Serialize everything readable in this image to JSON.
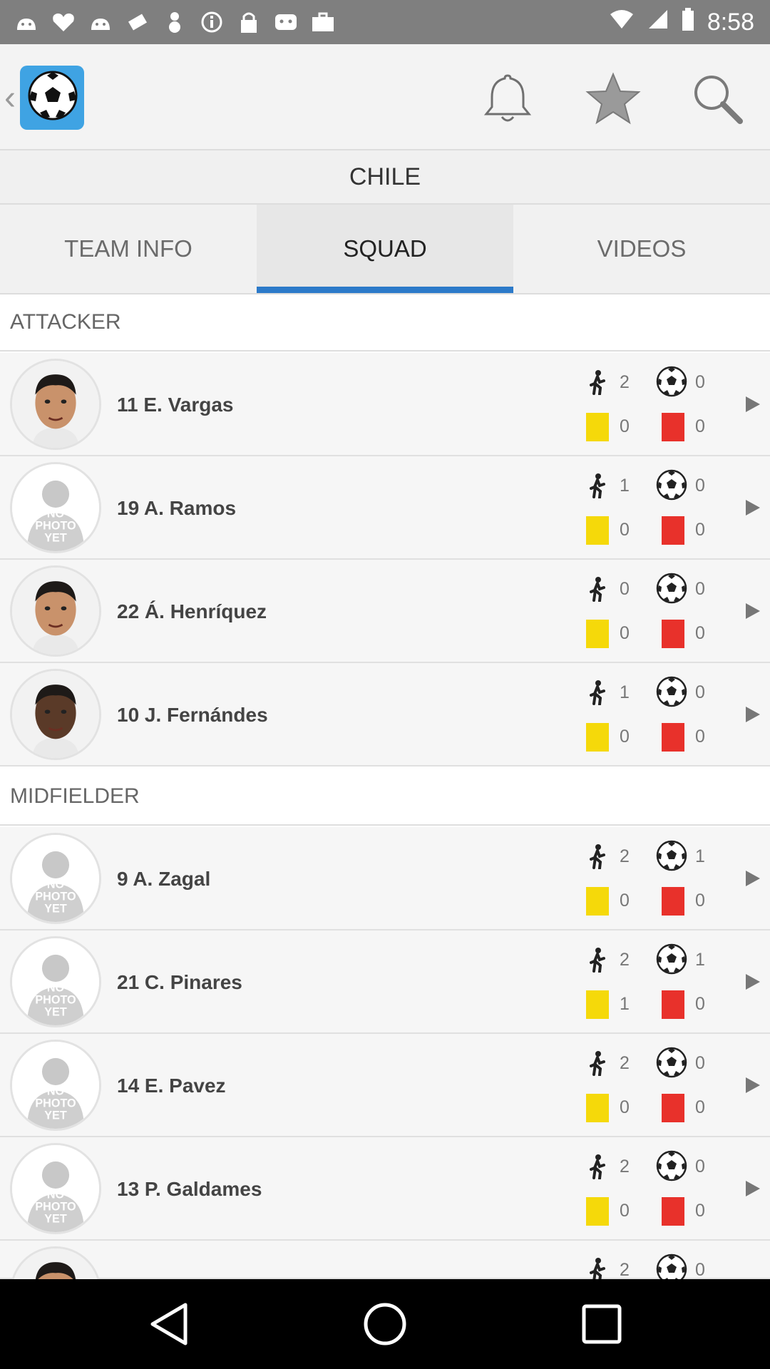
{
  "status_bar": {
    "time": "8:58",
    "left_icons": [
      "android-icon",
      "heart-icon",
      "android-icon",
      "fake-gps-icon",
      "android-icon",
      "info-icon",
      "lock-icon",
      "android-icon",
      "briefcase-icon"
    ],
    "right_icons": [
      "wifi-icon",
      "signal-icon",
      "battery-icon"
    ]
  },
  "app_bar": {
    "back_glyph": "‹",
    "actions": [
      "bell-icon",
      "star-icon",
      "search-icon"
    ]
  },
  "team": {
    "name": "CHILE"
  },
  "tabs": [
    {
      "label": "TEAM INFO",
      "active": false
    },
    {
      "label": "SQUAD",
      "active": true
    },
    {
      "label": "VIDEOS",
      "active": false
    }
  ],
  "sections": [
    {
      "title": "ATTACKER",
      "players": [
        {
          "name": "11 E. Vargas",
          "photo": "face",
          "apps": "2",
          "goals": "0",
          "yellow": "0",
          "red": "0"
        },
        {
          "name": "19 A. Ramos",
          "photo": "no-photo",
          "apps": "1",
          "goals": "0",
          "yellow": "0",
          "red": "0"
        },
        {
          "name": "22 Á. Henríquez",
          "photo": "face",
          "apps": "0",
          "goals": "0",
          "yellow": "0",
          "red": "0"
        },
        {
          "name": "10 J. Fernándes",
          "photo": "face-dark",
          "apps": "1",
          "goals": "0",
          "yellow": "0",
          "red": "0"
        }
      ]
    },
    {
      "title": "MIDFIELDER",
      "players": [
        {
          "name": "9 A. Zagal",
          "photo": "no-photo",
          "apps": "2",
          "goals": "1",
          "yellow": "0",
          "red": "0"
        },
        {
          "name": "21 C. Pinares",
          "photo": "no-photo",
          "apps": "2",
          "goals": "1",
          "yellow": "1",
          "red": "0"
        },
        {
          "name": "14 E. Pavez",
          "photo": "no-photo",
          "apps": "2",
          "goals": "0",
          "yellow": "0",
          "red": "0"
        },
        {
          "name": "13 P. Galdames",
          "photo": "no-photo",
          "apps": "2",
          "goals": "0",
          "yellow": "0",
          "red": "0"
        },
        {
          "name": "",
          "photo": "face",
          "apps": "2",
          "goals": "0",
          "yellow": "",
          "red": ""
        }
      ]
    }
  ],
  "no_photo_text": [
    "NO",
    "PHOTO",
    "YET"
  ],
  "colors": {
    "accent": "#2c7ac9",
    "yellow_card": "#f5d90a",
    "red_card": "#e8312b",
    "status_bar": "#7f7f7f"
  },
  "nav_bar": [
    "back-triangle-icon",
    "home-circle-icon",
    "recents-square-icon"
  ]
}
